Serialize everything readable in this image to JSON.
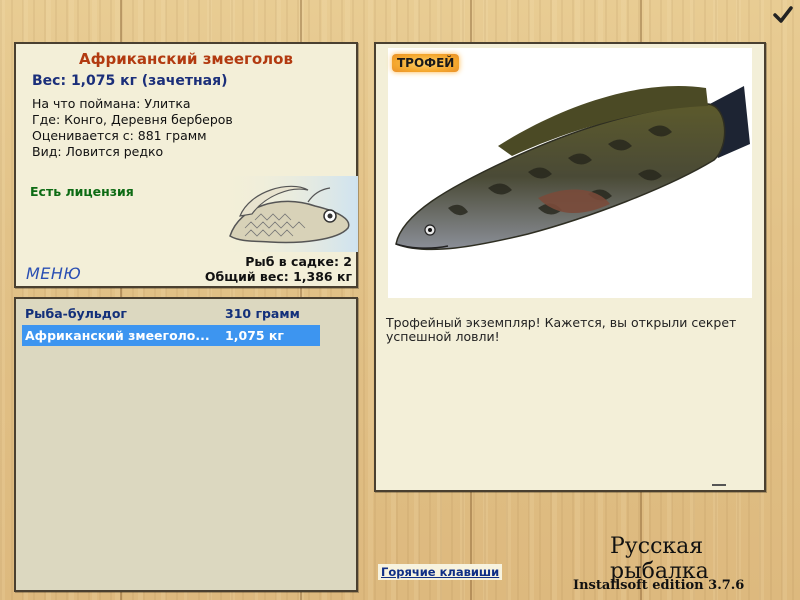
{
  "info": {
    "title": "Африканский змееголов",
    "weight_line": "Вес: 1,075 кг (зачетная)",
    "caught_on": "На что поймана: Улитка",
    "location": "Где: Конго, Деревня берберов",
    "value": "Оценивается с: 881 грамм",
    "kind": "Вид: Ловится редко",
    "license": "Есть лицензия",
    "menu_label": "МЕНЮ",
    "fish_in_keepnet": "Рыб в садке: 2",
    "total_weight": "Общий вес: 1,386 кг"
  },
  "catch_list": [
    {
      "name": "Рыба-бульдог",
      "weight": "310 грамм",
      "selected": false
    },
    {
      "name": "Африканский змееголо...",
      "weight": "1,075 кг",
      "selected": true
    }
  ],
  "detail": {
    "badge": "ТРОФЕЙ",
    "description": "Трофейный экземпляр! Кажется, вы открыли секрет успешной ловли!"
  },
  "footer": {
    "hotkeys_label": "Горячие клавиши",
    "game_title": "Русская рыбалка",
    "edition": "Installsoft edition 3.7.6"
  },
  "colors": {
    "accent_title": "#b23a10",
    "weight_blue": "#1b2f7a",
    "license_green": "#0d6b14",
    "selection_blue": "#3d95f0"
  },
  "icons": [
    "checkmark-icon",
    "fish-logo-icon"
  ]
}
